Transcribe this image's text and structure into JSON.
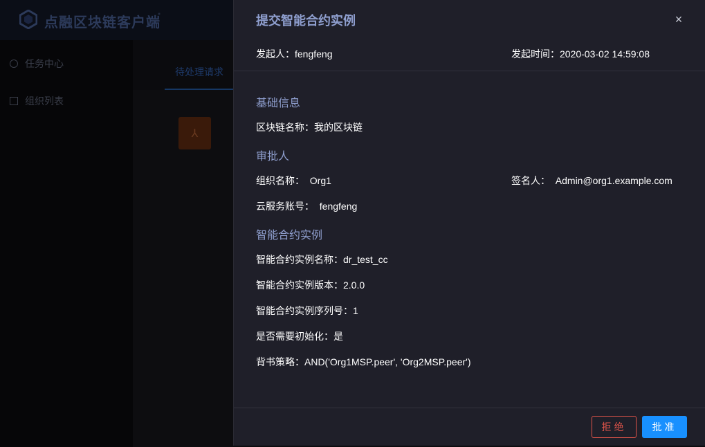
{
  "app": {
    "title": "点融区块链客户端"
  },
  "sidebar": {
    "items": [
      {
        "label": "任务中心",
        "icon": "clock-icon"
      },
      {
        "label": "组织列表",
        "icon": "list-icon"
      }
    ]
  },
  "main": {
    "tab_label": "待处理请求",
    "card_icon": "contract-icon"
  },
  "modal": {
    "title": "提交智能合约实例",
    "close_icon": "×",
    "initiator_label": "发起人：",
    "initiator": "fengfeng",
    "time_label": "发起时间：",
    "time": "2020-03-02 14:59:08",
    "sections": {
      "basic": {
        "title": "基础信息",
        "chain_name_label": "区块链名称：",
        "chain_name": "我的区块链"
      },
      "approver": {
        "title": "审批人",
        "org_label": "组织名称：",
        "org": "Org1",
        "signer_label": "签名人：",
        "signer": "Admin@org1.example.com",
        "cloud_account_label": "云服务账号：",
        "cloud_account": "fengfeng"
      },
      "contract": {
        "title": "智能合约实例",
        "name_label": "智能合约实例名称：",
        "name": "dr_test_cc",
        "version_label": "智能合约实例版本：",
        "version": "2.0.0",
        "sequence_label": "智能合约实例序列号：",
        "sequence": "1",
        "init_label": "是否需要初始化：",
        "init": "是",
        "policy_label": "背书策略：",
        "policy": "AND('Org1MSP.peer', 'Org2MSP.peer')"
      }
    },
    "buttons": {
      "reject": "拒绝",
      "approve": "批准"
    }
  },
  "colors": {
    "accent": "#1890ff",
    "danger": "#e0544a",
    "section_title": "#8f9fcf",
    "modal_bg": "#1f1f29"
  }
}
